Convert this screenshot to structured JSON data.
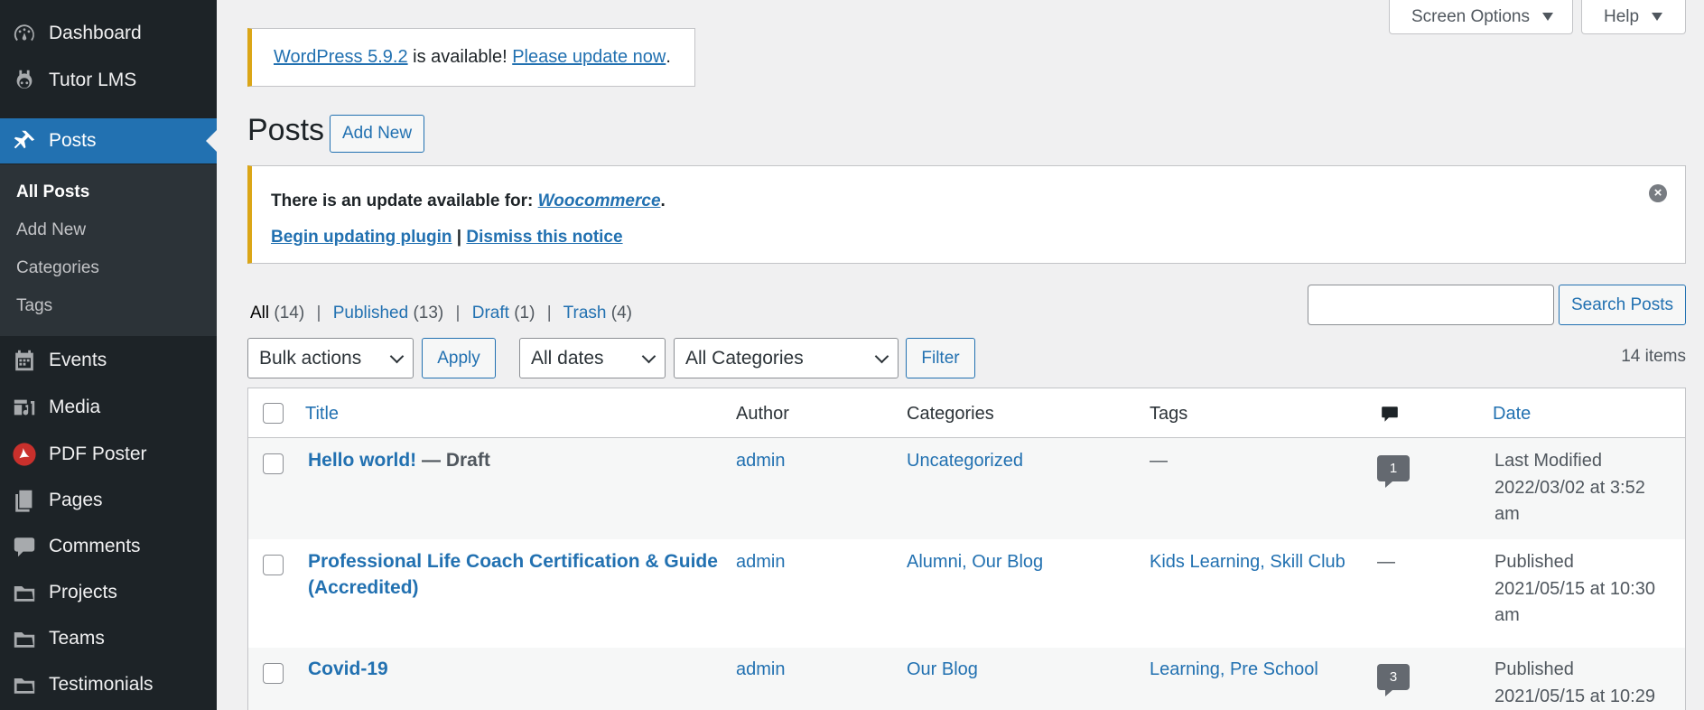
{
  "sidebar": {
    "items": [
      {
        "label": "Dashboard",
        "icon": "dashboard-icon"
      },
      {
        "label": "Tutor LMS",
        "icon": "tutor-icon"
      },
      {
        "label": "Posts",
        "icon": "pin-icon"
      },
      {
        "label": "Events",
        "icon": "calendar-icon"
      },
      {
        "label": "Media",
        "icon": "media-icon"
      },
      {
        "label": "PDF Poster",
        "icon": "pdf-icon"
      },
      {
        "label": "Pages",
        "icon": "pages-icon"
      },
      {
        "label": "Comments",
        "icon": "comment-icon"
      },
      {
        "label": "Projects",
        "icon": "folder-icon"
      },
      {
        "label": "Teams",
        "icon": "folder-icon"
      },
      {
        "label": "Testimonials",
        "icon": "folder-icon"
      }
    ],
    "submenu": [
      "All Posts",
      "Add New",
      "Categories",
      "Tags"
    ]
  },
  "screen_options": {
    "label": "Screen Options",
    "help": "Help"
  },
  "wp_notice": {
    "link1": "WordPress 5.9.2",
    "mid": " is available! ",
    "link2": "Please update now",
    "end": "."
  },
  "page": {
    "title": "Posts",
    "add_new": "Add New"
  },
  "plugin_notice": {
    "prefix": "There is an update available for: ",
    "plugin": "Woocommerce",
    "suffix": ".",
    "begin": "Begin updating plugin",
    "sep": " | ",
    "dismiss": "Dismiss this notice"
  },
  "filters": {
    "views": [
      {
        "label": "All",
        "count": "(14)"
      },
      {
        "label": "Published",
        "count": "(13)"
      },
      {
        "label": "Draft",
        "count": "(1)"
      },
      {
        "label": "Trash",
        "count": "(4)"
      }
    ],
    "search_button": "Search Posts",
    "bulk": "Bulk actions",
    "apply": "Apply",
    "dates": "All dates",
    "categories": "All Categories",
    "filter": "Filter",
    "items": "14 items"
  },
  "table": {
    "headers": {
      "title": "Title",
      "author": "Author",
      "categories": "Categories",
      "tags": "Tags",
      "date": "Date"
    },
    "rows": [
      {
        "title": "Hello world!",
        "state": " — Draft",
        "author": "admin",
        "categories": "Uncategorized",
        "tags": "—",
        "comments": "1",
        "date1": "Last Modified",
        "date2": "2022/03/02 at 3:52",
        "date3": "am"
      },
      {
        "title": "Professional Life Coach Certification & Guide",
        "title2": "(Accredited)",
        "author": "admin",
        "categories": "Alumni, Our Blog",
        "tags": "Kids Learning, Skill Club",
        "comments": "—",
        "date1": "Published",
        "date2": "2021/05/15 at 10:30",
        "date3": "am"
      },
      {
        "title": "Covid-19",
        "author": "admin",
        "categories": "Our Blog",
        "tags": "Learning, Pre School",
        "comments": "3",
        "date1": "Published",
        "date2": "2021/05/15 at 10:29"
      }
    ]
  },
  "colors": {
    "sidebar_bg": "#1d2327",
    "accent": "#2271b1",
    "notice": "#dba617"
  }
}
